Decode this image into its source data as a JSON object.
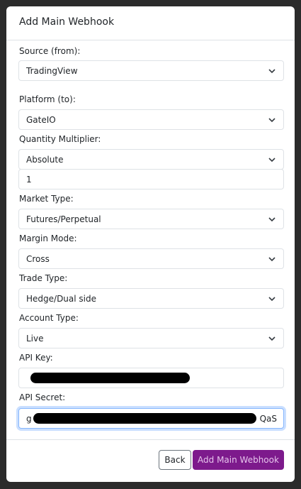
{
  "title": "Add Main Webhook",
  "fields": {
    "source": {
      "label": "Source (from):",
      "value": "TradingView"
    },
    "platform": {
      "label": "Platform (to):",
      "value": "GateIO"
    },
    "quantity_multiplier": {
      "label": "Quantity Multiplier:",
      "value": "Absolute",
      "amount": "1"
    },
    "market_type": {
      "label": "Market Type:",
      "value": "Futures/Perpetual"
    },
    "margin_mode": {
      "label": "Margin Mode:",
      "value": "Cross"
    },
    "trade_type": {
      "label": "Trade Type:",
      "value": "Hedge/Dual side"
    },
    "account_type": {
      "label": "Account Type:",
      "value": "Live"
    },
    "api_key": {
      "label": "API Key:"
    },
    "api_secret": {
      "label": "API Secret:",
      "visible_start": "g",
      "visible_end": "QaS"
    }
  },
  "buttons": {
    "back": "Back",
    "add": "Add Main Webhook"
  },
  "colors": {
    "primary": "#7d1a8c",
    "focus": "#86b7fe",
    "border": "#dee2e6"
  },
  "icons": {
    "select_arrow": "chevron-down-icon"
  }
}
